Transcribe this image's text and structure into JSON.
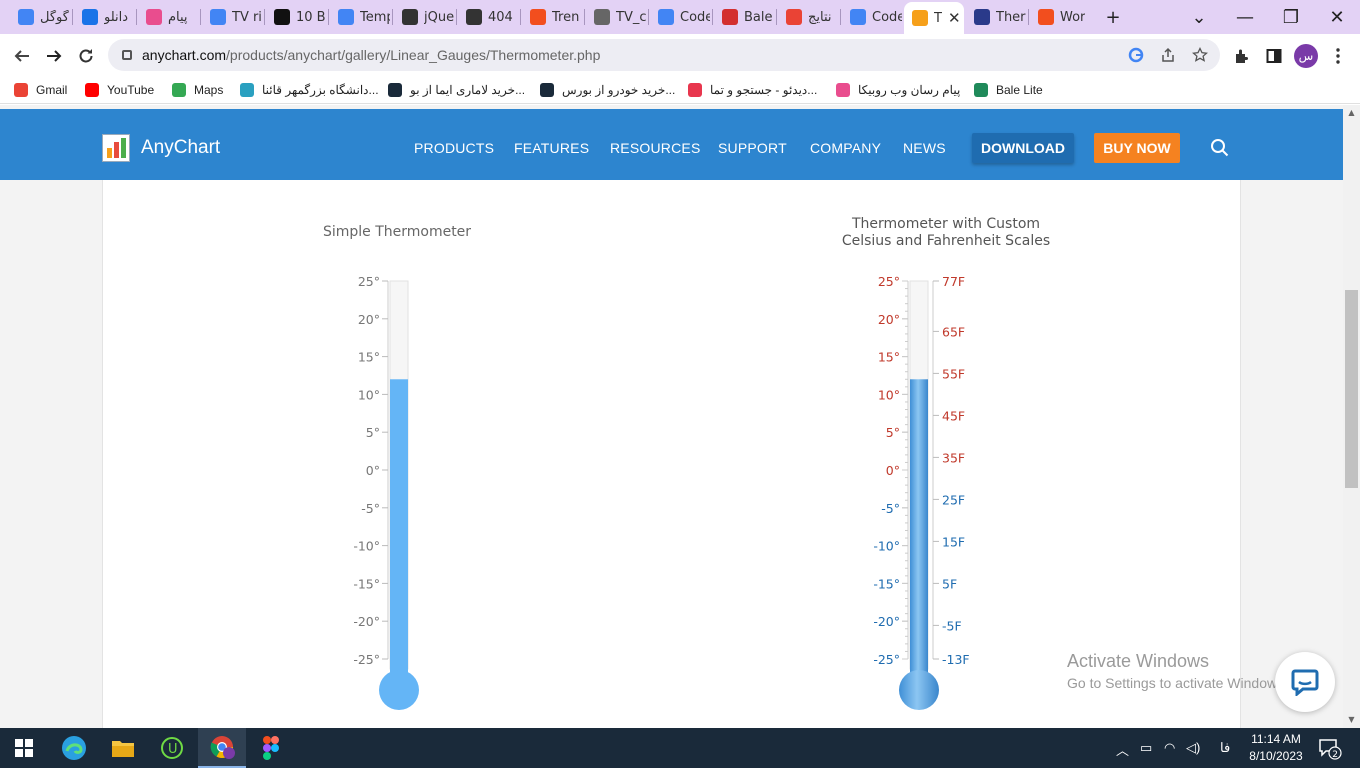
{
  "browser": {
    "tabs": [
      {
        "label": "گوگل",
        "icon": "google-icon",
        "color": "#4285f4"
      },
      {
        "label": "دانلو",
        "icon": "s-logo-icon",
        "color": "#1a73e8"
      },
      {
        "label": "پیام",
        "icon": "rubika-icon",
        "color": "#e94d8e"
      },
      {
        "label": "TV ri",
        "icon": "google-icon",
        "color": "#4285f4"
      },
      {
        "label": "10 B",
        "icon": "bb-icon",
        "color": "#111111"
      },
      {
        "label": "Temp",
        "icon": "google-icon",
        "color": "#4285f4"
      },
      {
        "label": "jQue",
        "icon": "swirl-icon",
        "color": "#333333"
      },
      {
        "label": "404",
        "icon": "swirl-icon",
        "color": "#333333"
      },
      {
        "label": "Tren",
        "icon": "figma-icon",
        "color": "#f24e1e"
      },
      {
        "label": "TV_c",
        "icon": "globe-icon",
        "color": "#666666"
      },
      {
        "label": "Code",
        "icon": "google-icon",
        "color": "#4285f4"
      },
      {
        "label": "Bale",
        "icon": "bale-icon",
        "color": "#d32f2f"
      },
      {
        "label": "نتایج",
        "icon": "gmail-icon",
        "color": "#ea4335"
      },
      {
        "label": "Code",
        "icon": "google-icon",
        "color": "#4285f4"
      },
      {
        "label": "T",
        "icon": "anychart-icon",
        "color": "#f6a01a",
        "active": true
      },
      {
        "label": "Ther",
        "icon": "h-logo-icon",
        "color": "#2a3a8a"
      },
      {
        "label": "Wor",
        "icon": "figma-icon",
        "color": "#f24e1e"
      }
    ],
    "new_tab": "+",
    "url_host": "anychart.com",
    "url_path": "/products/anychart/gallery/Linear_Gauges/Thermometer.php",
    "profile_initial": "س",
    "bookmarks": [
      {
        "label": "Gmail",
        "icon": "gmail-icon"
      },
      {
        "label": "YouTube",
        "icon": "youtube-icon"
      },
      {
        "label": "Maps",
        "icon": "maps-icon"
      },
      {
        "label": "دانشگاه بزرگمهر قائنا...",
        "icon": "university-icon"
      },
      {
        "label": "خرید لاماری ایما از بو...",
        "icon": "bird-icon"
      },
      {
        "label": "خرید خودرو از بورس...",
        "icon": "bird-icon"
      },
      {
        "label": "دیدئو - جستجو و تما...",
        "icon": "video-icon"
      },
      {
        "label": "پیام رسان وب روبیکا",
        "icon": "rubika-icon"
      },
      {
        "label": "Bale Lite",
        "icon": "bale-icon"
      }
    ]
  },
  "site": {
    "brand": "AnyChart",
    "nav": [
      "PRODUCTS",
      "FEATURES",
      "RESOURCES",
      "SUPPORT",
      "COMPANY",
      "NEWS"
    ],
    "download": "DOWNLOAD",
    "buy_now": "BUY NOW"
  },
  "colors": {
    "nav_bg": "#2d85cf",
    "buy_now": "#f58220",
    "download": "#1f6cb0",
    "thermo_fill": "#64b5f6",
    "celsius_warm": "#c0392b",
    "celsius_cool": "#1f6cb0"
  },
  "chart_data": [
    {
      "type": "thermometer",
      "title": "Simple Thermometer",
      "value": 12,
      "scale": {
        "min": -25,
        "max": 25,
        "interval": 5,
        "suffix": "°"
      },
      "tick_labels": [
        "25°",
        "20°",
        "15°",
        "10°",
        "5°",
        "0°",
        "-5°",
        "-10°",
        "-15°",
        "-20°",
        "-25°"
      ]
    },
    {
      "type": "thermometer",
      "title_lines": [
        "Thermometer with Custom",
        "Celsius and Fahrenheit Scales"
      ],
      "value": 12,
      "scale": {
        "min": -25,
        "max": 25,
        "interval": 5,
        "suffix": "°"
      },
      "tick_labels": [
        "25°",
        "20°",
        "15°",
        "10°",
        "5°",
        "0°",
        "-5°",
        "-10°",
        "-15°",
        "-20°",
        "-25°"
      ],
      "fahrenheit_labels": [
        {
          "value": 77,
          "label": "77F"
        },
        {
          "value": 65,
          "label": "65F"
        },
        {
          "value": 55,
          "label": "55F"
        },
        {
          "value": 45,
          "label": "45F"
        },
        {
          "value": 35,
          "label": "35F"
        },
        {
          "value": 25,
          "label": "25F"
        },
        {
          "value": 15,
          "label": "15F"
        },
        {
          "value": 5,
          "label": "5F"
        },
        {
          "value": -5,
          "label": "-5F"
        },
        {
          "value": -13,
          "label": "-13F"
        }
      ]
    }
  ],
  "watermark": {
    "line1": "Activate Windows",
    "line2": "Go to Settings to activate Windows."
  },
  "taskbar": {
    "lang": "فا",
    "time": "11:14 AM",
    "date": "8/10/2023",
    "notifications": "2"
  }
}
